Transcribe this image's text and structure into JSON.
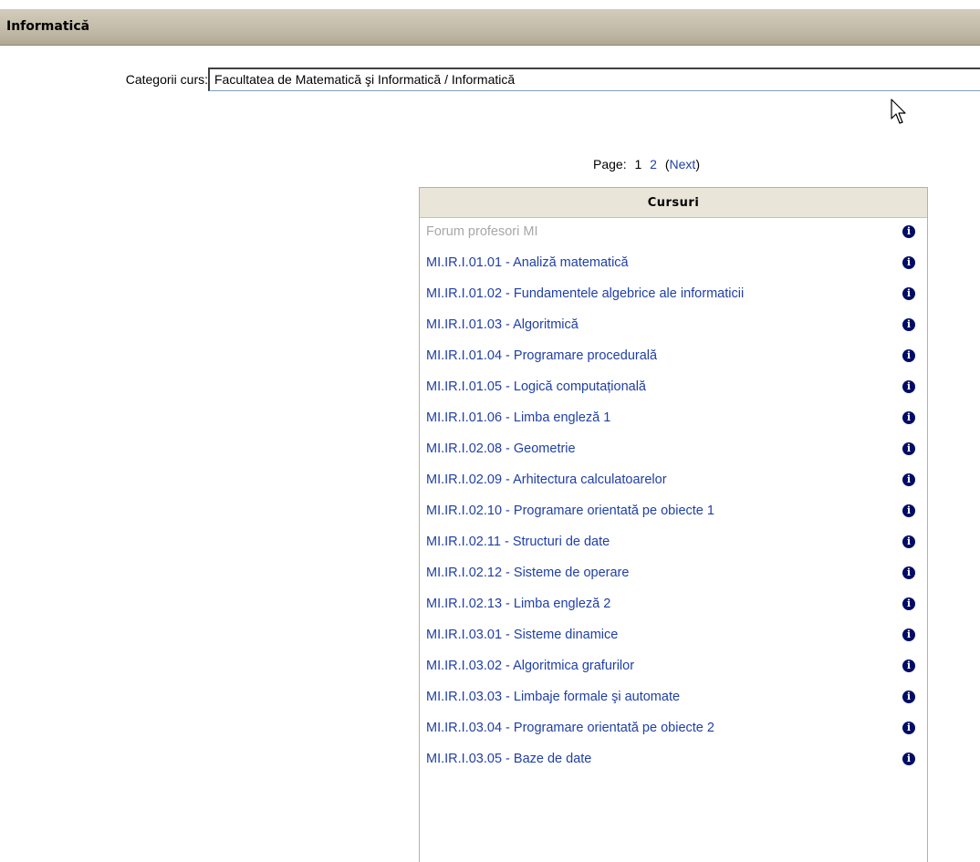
{
  "header": {
    "title": "Informatică"
  },
  "category": {
    "label": "Categorii curs:",
    "selected": "Facultatea de Matematică şi Informatică / Informatică"
  },
  "paging": {
    "label": "Page:",
    "current": "1",
    "page2": "2",
    "next_open": "(",
    "next": "Next",
    "next_close": ")"
  },
  "courses": {
    "header": "Cursuri",
    "info_icon": "info-icon",
    "items": [
      {
        "label": "Forum profesori MI",
        "hidden": true
      },
      {
        "label": "MI.IR.I.01.01 - Analiză matematică"
      },
      {
        "label": "MI.IR.I.01.02 - Fundamentele algebrice ale informaticii"
      },
      {
        "label": "MI.IR.I.01.03 - Algoritmică"
      },
      {
        "label": "MI.IR.I.01.04 - Programare procedurală"
      },
      {
        "label": "MI.IR.I.01.05 - Logică computațională"
      },
      {
        "label": "MI.IR.I.01.06 - Limba engleză 1"
      },
      {
        "label": "MI.IR.I.02.08 - Geometrie"
      },
      {
        "label": "MI.IR.I.02.09 - Arhitectura calculatoarelor"
      },
      {
        "label": "MI.IR.I.02.10 - Programare orientată pe obiecte 1"
      },
      {
        "label": "MI.IR.I.02.11 - Structuri de date"
      },
      {
        "label": "MI.IR.I.02.12 - Sisteme de operare"
      },
      {
        "label": "MI.IR.I.02.13 - Limba engleză 2"
      },
      {
        "label": "MI.IR.I.03.01 - Sisteme dinamice"
      },
      {
        "label": "MI.IR.I.03.02 - Algoritmica grafurilor"
      },
      {
        "label": "MI.IR.I.03.03 - Limbaje formale şi automate"
      },
      {
        "label": "MI.IR.I.03.04 - Programare orientată pe obiecte 2"
      },
      {
        "label": "MI.IR.I.03.05 - Baze de date"
      }
    ]
  },
  "colors": {
    "link": "#1f3fa6",
    "dimmed_link": "#a7a7a7",
    "header_bar": "#bfb7a4",
    "box_header": "#e9e5d9",
    "info_icon": "#000c66"
  }
}
